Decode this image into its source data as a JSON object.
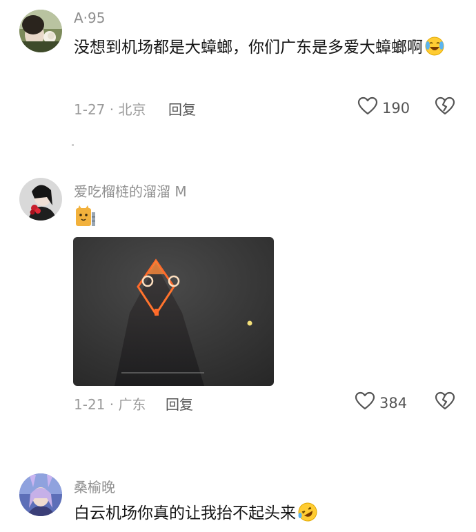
{
  "comments": [
    {
      "username": "A·95",
      "text": "没想到机场都是大蟑螂，你们广东是多爱大蟑螂啊",
      "emoji": "crying-laughing-emoji",
      "date_location": "1-27 · 北京",
      "reply_label": "回复",
      "likes": "190"
    },
    {
      "username": "爱吃榴梿的溜溜 M",
      "sticker": "cat-sticker",
      "date_location": "1-21 · 广东",
      "reply_label": "回复",
      "likes": "384"
    },
    {
      "username": "桑榆晚",
      "text": "白云机场你真的让我抬不起头来",
      "emoji": "rofl-emoji"
    }
  ],
  "icons": {
    "like": "heart-outline-icon",
    "dislike": "broken-heart-icon"
  },
  "colors": {
    "text": "#141414",
    "muted": "#9a9a9a",
    "photo_bg": "#3a3a3a",
    "tower_glow": "#ff6a2a"
  }
}
